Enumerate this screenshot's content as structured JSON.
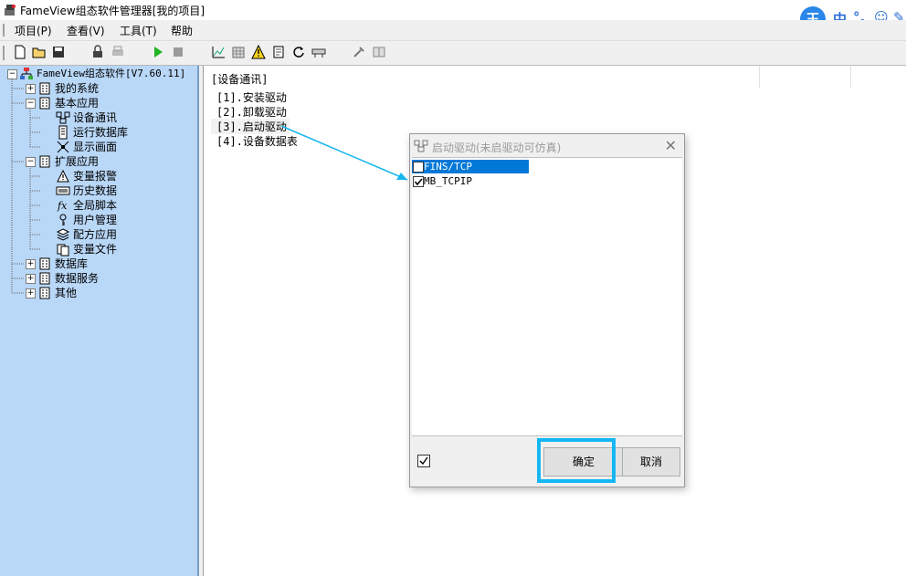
{
  "app": {
    "title": "FameView组态软件管理器[我的项目]"
  },
  "ime": {
    "logo": "王",
    "glyphs": [
      "中",
      "°,",
      "☺",
      "✎"
    ]
  },
  "menu": [
    {
      "label": "项目(P)"
    },
    {
      "label": "查看(V)"
    },
    {
      "label": "工具(T)"
    },
    {
      "label": "帮助"
    }
  ],
  "toolbar": {
    "icons": [
      "new-file-icon",
      "open-folder-icon",
      "save-icon",
      "lock-icon",
      "print-icon",
      "run-icon",
      "stop-icon",
      "chart-icon",
      "grid-icon",
      "warning-icon",
      "page-icon",
      "refresh-icon",
      "database-icon",
      "tools-icon",
      "book-icon"
    ]
  },
  "tree": {
    "root": "FameView组态软件[V7.60.11]",
    "nodes": [
      {
        "label": "我的系统",
        "expander": "+"
      },
      {
        "label": "基本应用",
        "expander": "-"
      },
      {
        "label": "设备通讯"
      },
      {
        "label": "运行数据库"
      },
      {
        "label": "显示画面"
      },
      {
        "label": "扩展应用",
        "expander": "-"
      },
      {
        "label": "变量报警"
      },
      {
        "label": "历史数据"
      },
      {
        "label": "全局脚本"
      },
      {
        "label": "用户管理"
      },
      {
        "label": "配方应用"
      },
      {
        "label": "变量文件"
      },
      {
        "label": "数据库",
        "expander": "+"
      },
      {
        "label": "数据服务",
        "expander": "+"
      },
      {
        "label": "其他",
        "expander": "+"
      }
    ]
  },
  "content": {
    "header": "[设备通讯]",
    "lines": [
      "[1].安装驱动",
      "[2].卸载驱动",
      "[3].启动驱动",
      "[4].设备数据表"
    ]
  },
  "dialog": {
    "title": "启动驱动(未启驱动可仿真)",
    "close": "✕",
    "items": [
      {
        "label": "FINS/TCP",
        "checked": false,
        "selected": true
      },
      {
        "label": "MB_TCPIP",
        "checked": true,
        "selected": false
      }
    ],
    "footer_check": "✓",
    "ok_label": "确定",
    "cancel_label": "取消"
  },
  "colors": {
    "tree_bg": "#b9d7f7",
    "selection": "#0078d7",
    "highlight": "#15b7f2"
  }
}
